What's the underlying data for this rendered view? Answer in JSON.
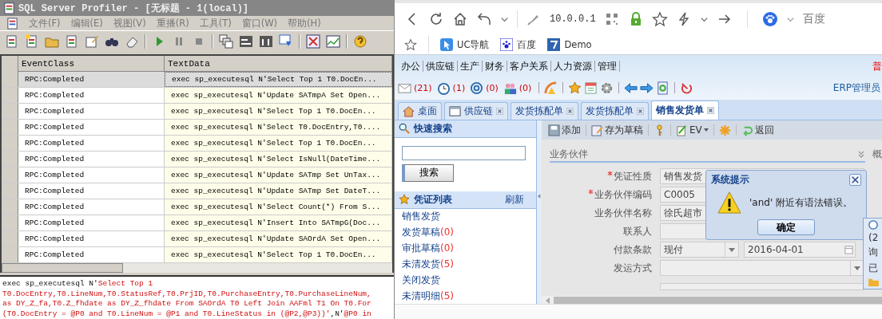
{
  "profiler": {
    "title": "SQL Server Profiler - [无标题 - 1(local)]",
    "menu": [
      "文件(F)",
      "编辑(E)",
      "视图(V)",
      "重播(R)",
      "工具(T)",
      "窗口(W)",
      "帮助(H)"
    ],
    "columns": [
      "EventClass",
      "TextData"
    ],
    "rows": [
      {
        "event": "RPC:Completed",
        "text": "exec sp_executesql N'Select Top 1  T0.DocEn...",
        "selected": true
      },
      {
        "event": "RPC:Completed",
        "text": "exec sp_executesql N'Update SATmpA Set Open...",
        "selected": false
      },
      {
        "event": "RPC:Completed",
        "text": "exec sp_executesql N'Select Top 1  T0.DocEn...",
        "selected": false
      },
      {
        "event": "RPC:Completed",
        "text": "exec sp_executesql N'Select T0.DocEntry,T0....",
        "selected": false
      },
      {
        "event": "RPC:Completed",
        "text": "exec sp_executesql N'Select Top 1  T0.DocEn...",
        "selected": false
      },
      {
        "event": "RPC:Completed",
        "text": "exec sp_executesql N'Select IsNull(DateTime...",
        "selected": false
      },
      {
        "event": "RPC:Completed",
        "text": "exec sp_executesql N'Update SATmp Set UnTax...",
        "selected": false
      },
      {
        "event": "RPC:Completed",
        "text": "exec sp_executesql N'Update SATmp Set DateT...",
        "selected": false
      },
      {
        "event": "RPC:Completed",
        "text": "exec sp_executesql N'Select Count(*) From S...",
        "selected": false
      },
      {
        "event": "RPC:Completed",
        "text": "exec sp_executesql N'Insert Into SATmpG(Doc...",
        "selected": false
      },
      {
        "event": "RPC:Completed",
        "text": "exec sp_executesql N'Update SAOrdA Set Open...",
        "selected": false
      },
      {
        "event": "RPC:Completed",
        "text": "exec sp_executesql N'Select Top 1  T0.DocEn...",
        "selected": false
      }
    ],
    "sql_lines": [
      [
        {
          "kind": "plain",
          "text": "exec sp_executesql N'"
        },
        {
          "kind": "string",
          "text": "Select Top 1"
        }
      ],
      [
        {
          "kind": "string",
          "text": "T0.DocEntry,T0.LineNum,T0.StatusRef,T0.PrjID,T0.PurchaseEntry,T0.PurchaseLineNum,"
        }
      ],
      [
        {
          "kind": "string",
          "text": "as DY_Z_fa,T0.Z_fhdate as DY_Z_fhdate From SAOrdA T0 Left Join AAFml T1 On T0.For"
        }
      ],
      [
        {
          "kind": "string",
          "text": "(T0.DocEntry = @P0 and T0.LineNum = @P1 and T0.LineStatus in (@P2,@P3))'"
        },
        {
          "kind": "plain",
          "text": ",N'"
        },
        {
          "kind": "string",
          "text": "@P0 in"
        }
      ]
    ]
  },
  "browser": {
    "address": "10.0.0.1",
    "search_engine": "百度",
    "bookmarks": [
      "UC导航",
      "百度",
      "Demo"
    ],
    "erp": {
      "menu": [
        "办公",
        "供应链",
        "生产",
        "财务",
        "客户关系",
        "人力资源",
        "管理"
      ],
      "menu_extra": "普",
      "counters": [
        {
          "kind": "mail",
          "count": "(21)"
        },
        {
          "kind": "clock",
          "count": "(1)"
        },
        {
          "kind": "at",
          "count": "(0)"
        },
        {
          "kind": "people",
          "count": "(0)"
        }
      ],
      "user": "ERP管理员",
      "tabs": [
        {
          "label": "桌面",
          "closable": false,
          "selected": false
        },
        {
          "label": "供应链",
          "closable": true,
          "selected": false
        },
        {
          "label": "发货拣配单",
          "closable": true,
          "selected": false
        },
        {
          "label": "发货拣配单",
          "closable": true,
          "selected": false
        },
        {
          "label": "销售发货单",
          "closable": true,
          "selected": true
        }
      ],
      "sidebar": {
        "search_title": "快速搜索",
        "search_button": "搜索",
        "list_title": "凭证列表",
        "refresh": "刷新",
        "items": [
          {
            "label": "销售发货"
          },
          {
            "label": "发货草稿",
            "count": "(0)"
          },
          {
            "label": "审批草稿",
            "count": "(0)"
          },
          {
            "label": "未清发货",
            "count": "(5)"
          },
          {
            "label": "关闭发货"
          },
          {
            "label": "未清明细",
            "count": "(5)"
          }
        ]
      },
      "toolbar": [
        {
          "kind": "save",
          "label": "添加"
        },
        {
          "kind": "draft",
          "label": "存为草稿"
        },
        {
          "kind": "key"
        },
        {
          "kind": "ev",
          "label": "EV"
        },
        {
          "kind": "asterisk"
        },
        {
          "kind": "back",
          "label": "返回"
        }
      ],
      "section": "业务伙伴",
      "section_next": "概",
      "fields": [
        {
          "label": "凭证性质",
          "required": true,
          "kind": "text",
          "value": "销售发货"
        },
        {
          "label": "业务伙伴编码",
          "required": true,
          "kind": "text",
          "value": "C0005"
        },
        {
          "label": "业务伙伴名称",
          "required": false,
          "kind": "text",
          "value": "徐氏超市"
        },
        {
          "label": "联系人",
          "required": false,
          "kind": "text"
        },
        {
          "label": "付款条款",
          "required": false,
          "kind": "select",
          "value": "现付",
          "date": "2016-04-01"
        },
        {
          "label": "发运方式",
          "required": false,
          "kind": "select"
        }
      ],
      "dialog": {
        "title": "系统提示",
        "message": "'and' 附近有语法错误。",
        "button": "确定"
      },
      "notice": [
        "(2",
        "询",
        "已"
      ]
    }
  }
}
